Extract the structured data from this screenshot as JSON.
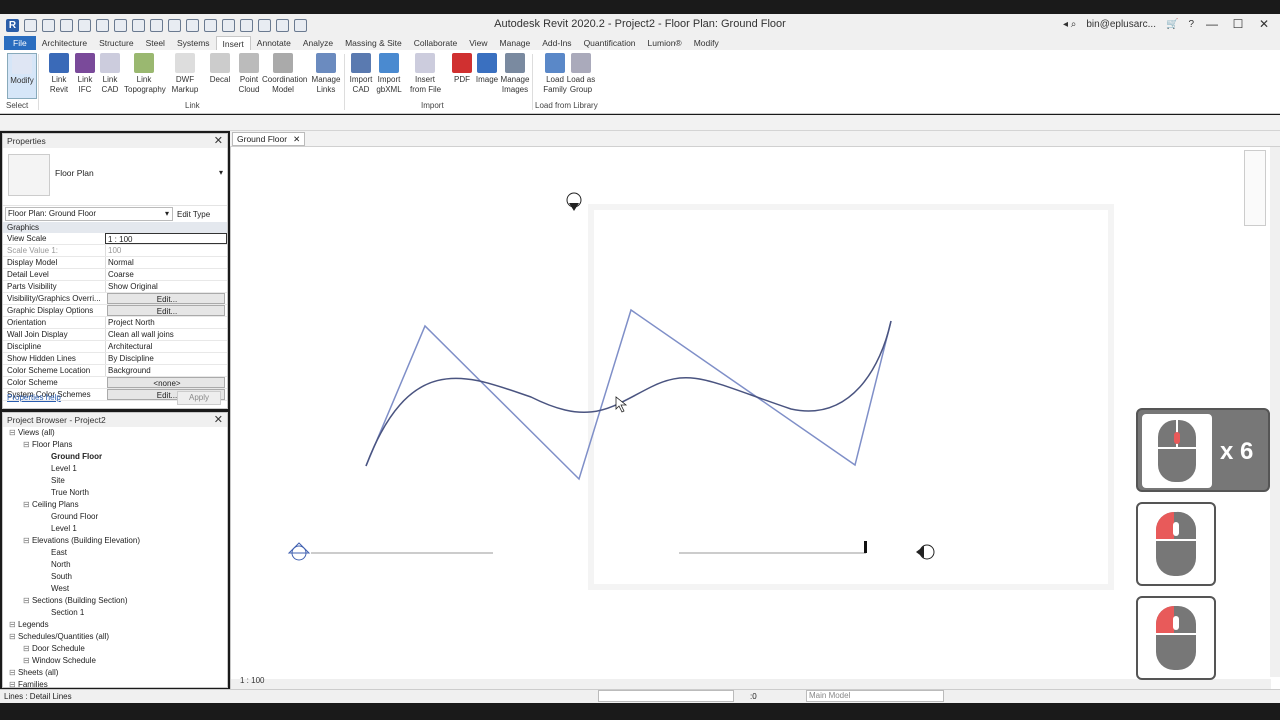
{
  "window": {
    "title": "Autodesk Revit 2020.2 - Project2 - Floor Plan: Ground Floor",
    "user": "bin@eplusarc..."
  },
  "tabs": [
    "File",
    "Architecture",
    "Structure",
    "Steel",
    "Systems",
    "Insert",
    "Annotate",
    "Analyze",
    "Massing & Site",
    "Collaborate",
    "View",
    "Manage",
    "Add-Ins",
    "Quantification",
    "Lumion®",
    "Modify"
  ],
  "active_tab": "Insert",
  "ribbon": {
    "buttons": [
      {
        "label": "Modify",
        "icon": "cursor-icon"
      },
      {
        "label": "Link\nRevit",
        "icon": "link-revit-icon"
      },
      {
        "label": "Link\nIFC",
        "icon": "link-ifc-icon"
      },
      {
        "label": "Link\nCAD",
        "icon": "link-cad-icon"
      },
      {
        "label": "Link\nTopography",
        "icon": "link-topography-icon"
      },
      {
        "label": "DWF\nMarkup",
        "icon": "dwf-markup-icon"
      },
      {
        "label": "Decal",
        "icon": "decal-icon"
      },
      {
        "label": "Point\nCloud",
        "icon": "point-cloud-icon"
      },
      {
        "label": "Coordination\nModel",
        "icon": "coordination-model-icon"
      },
      {
        "label": "Manage\nLinks",
        "icon": "manage-links-icon"
      },
      {
        "label": "Import\nCAD",
        "icon": "import-cad-icon"
      },
      {
        "label": "Import\ngbXML",
        "icon": "import-gbxml-icon"
      },
      {
        "label": "Insert\nfrom File",
        "icon": "insert-from-file-icon"
      },
      {
        "label": "PDF",
        "icon": "pdf-icon"
      },
      {
        "label": "Image",
        "icon": "image-icon"
      },
      {
        "label": "Manage\nImages",
        "icon": "manage-images-icon"
      },
      {
        "label": "Load\nFamily",
        "icon": "load-family-icon"
      },
      {
        "label": "Load as\nGroup",
        "icon": "load-as-group-icon"
      }
    ],
    "groups": {
      "select": "Select",
      "link": "Link",
      "import": "Import",
      "load": "Load from Library"
    }
  },
  "properties": {
    "title": "Properties",
    "type_name": "Floor Plan",
    "instance_selector": "Floor Plan: Ground Floor",
    "edit_type": "Edit Type",
    "section": "Graphics",
    "rows": [
      {
        "k": "View Scale",
        "v": "1 : 100"
      },
      {
        "k": "Scale Value    1:",
        "v": "100"
      },
      {
        "k": "Display Model",
        "v": "Normal"
      },
      {
        "k": "Detail Level",
        "v": "Coarse"
      },
      {
        "k": "Parts Visibility",
        "v": "Show Original"
      },
      {
        "k": "Visibility/Graphics Overri...",
        "v": "Edit..."
      },
      {
        "k": "Graphic Display Options",
        "v": "Edit..."
      },
      {
        "k": "Orientation",
        "v": "Project North"
      },
      {
        "k": "Wall Join Display",
        "v": "Clean all wall joins"
      },
      {
        "k": "Discipline",
        "v": "Architectural"
      },
      {
        "k": "Show Hidden Lines",
        "v": "By Discipline"
      },
      {
        "k": "Color Scheme Location",
        "v": "Background"
      },
      {
        "k": "Color Scheme",
        "v": "<none>"
      },
      {
        "k": "System Color Schemes",
        "v": "Edit..."
      }
    ],
    "help": "Properties help",
    "apply": "Apply"
  },
  "browser": {
    "title": "Project Browser - Project2",
    "items": [
      {
        "t": "Views (all)",
        "lvl": 0
      },
      {
        "t": "Floor Plans",
        "lvl": 1
      },
      {
        "t": "Ground Floor",
        "lvl": 2,
        "bold": true
      },
      {
        "t": "Level 1",
        "lvl": 2
      },
      {
        "t": "Site",
        "lvl": 2
      },
      {
        "t": "True North",
        "lvl": 2
      },
      {
        "t": "Ceiling Plans",
        "lvl": 1
      },
      {
        "t": "Ground Floor",
        "lvl": 2
      },
      {
        "t": "Level 1",
        "lvl": 2
      },
      {
        "t": "Elevations (Building Elevation)",
        "lvl": 1
      },
      {
        "t": "East",
        "lvl": 2
      },
      {
        "t": "North",
        "lvl": 2
      },
      {
        "t": "South",
        "lvl": 2
      },
      {
        "t": "West",
        "lvl": 2
      },
      {
        "t": "Sections (Building Section)",
        "lvl": 1
      },
      {
        "t": "Section 1",
        "lvl": 2
      },
      {
        "t": "Legends",
        "lvl": 0
      },
      {
        "t": "Schedules/Quantities (all)",
        "lvl": 0
      },
      {
        "t": "Door Schedule",
        "lvl": 1
      },
      {
        "t": "Window Schedule",
        "lvl": 1
      },
      {
        "t": "Sheets (all)",
        "lvl": 0
      },
      {
        "t": "Families",
        "lvl": 0
      }
    ]
  },
  "view": {
    "tab": "Ground Floor",
    "scale": "1 : 100"
  },
  "status": {
    "left": "Lines : Detail Lines",
    "zero": ":0",
    "model": "Main Model"
  },
  "overlay": {
    "multiplier": "x 6",
    "colors": {
      "accent": "#e85a5a",
      "body": "#777777"
    }
  }
}
